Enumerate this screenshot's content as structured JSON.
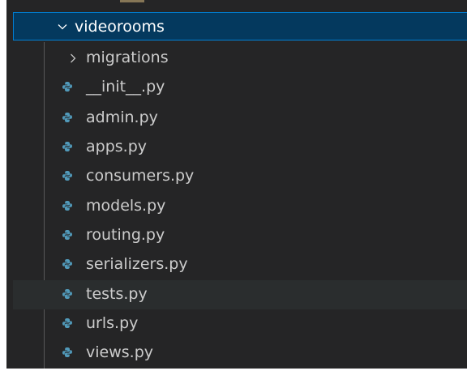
{
  "explorer": {
    "folder": {
      "label": "videorooms",
      "icon": "chevron-down-icon"
    },
    "children": [
      {
        "label": "migrations",
        "type": "folder",
        "icon": "chevron-right-icon"
      },
      {
        "label": "__init__.py",
        "type": "file",
        "icon": "python-icon"
      },
      {
        "label": "admin.py",
        "type": "file",
        "icon": "python-icon"
      },
      {
        "label": "apps.py",
        "type": "file",
        "icon": "python-icon"
      },
      {
        "label": "consumers.py",
        "type": "file",
        "icon": "python-icon"
      },
      {
        "label": "models.py",
        "type": "file",
        "icon": "python-icon"
      },
      {
        "label": "routing.py",
        "type": "file",
        "icon": "python-icon"
      },
      {
        "label": "serializers.py",
        "type": "file",
        "icon": "python-icon"
      },
      {
        "label": "tests.py",
        "type": "file",
        "icon": "python-icon",
        "hovered": true
      },
      {
        "label": "urls.py",
        "type": "file",
        "icon": "python-icon"
      },
      {
        "label": "views.py",
        "type": "file",
        "icon": "python-icon"
      }
    ]
  },
  "colors": {
    "background": "#252526",
    "selection": "#04395e",
    "focus_border": "#007fd4",
    "hover": "#2a2d2e",
    "text": "#cccccc",
    "python_icon_blue": "#519aba"
  }
}
